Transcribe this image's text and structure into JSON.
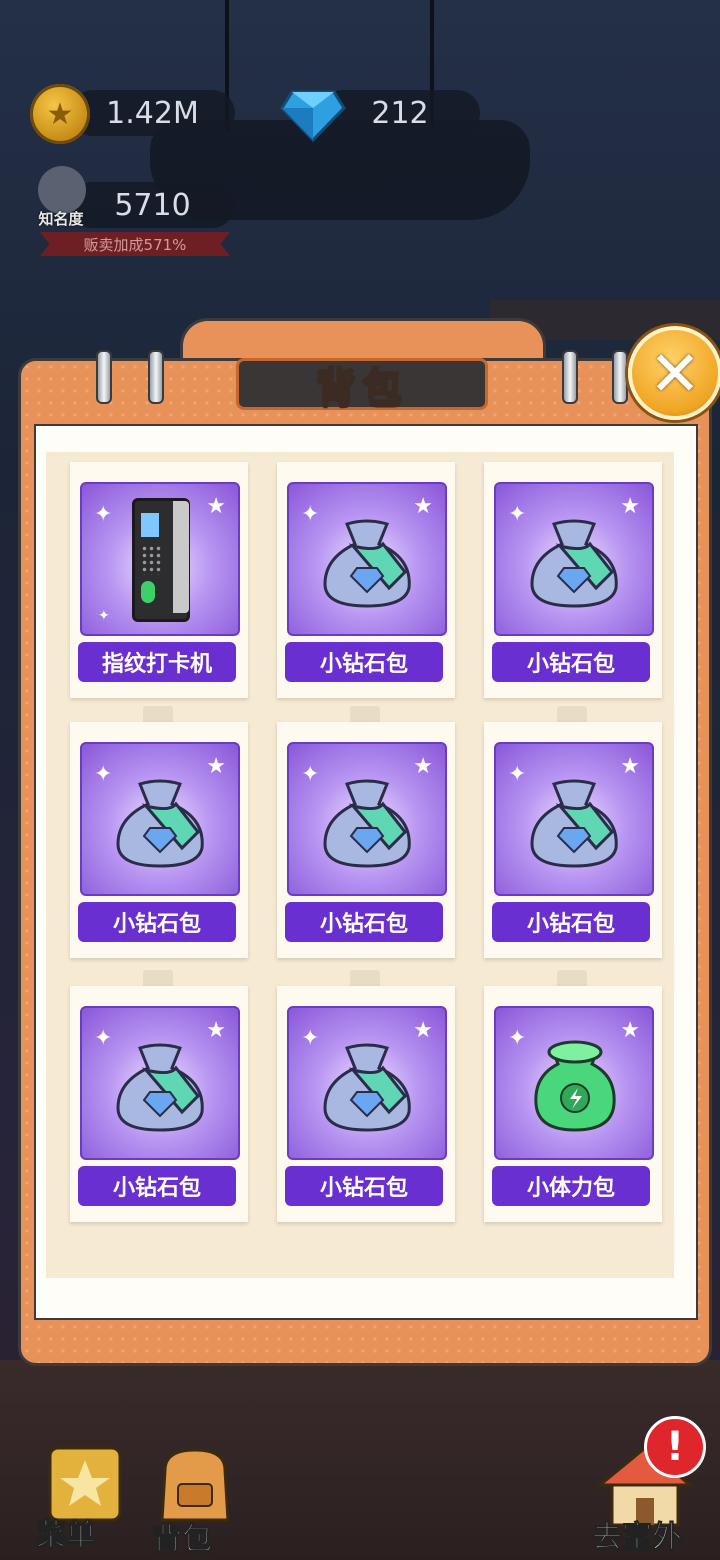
{
  "hud": {
    "coins": "1.42M",
    "diamonds": "212",
    "fame_value": "5710",
    "fame_label": "知名度",
    "sales_bonus": "贩卖加成571%"
  },
  "panel": {
    "title": "背包",
    "close_symbol": "✕"
  },
  "items": [
    {
      "name": "指纹打卡机",
      "icon": "fingerprint-clock-icon"
    },
    {
      "name": "小钻石包",
      "icon": "diamond-bag-icon"
    },
    {
      "name": "小钻石包",
      "icon": "diamond-bag-icon"
    },
    {
      "name": "小钻石包",
      "icon": "diamond-bag-icon"
    },
    {
      "name": "小钻石包",
      "icon": "diamond-bag-icon"
    },
    {
      "name": "小钻石包",
      "icon": "diamond-bag-icon"
    },
    {
      "name": "小钻石包",
      "icon": "diamond-bag-icon"
    },
    {
      "name": "小钻石包",
      "icon": "diamond-bag-icon"
    },
    {
      "name": "小体力包",
      "icon": "stamina-bag-icon"
    }
  ],
  "bottom_nav": {
    "menu": "菜单",
    "bag": "背包",
    "outdoor": "去室外",
    "alert_symbol": "!"
  },
  "colors": {
    "panel_orange": "#e8925a",
    "label_purple": "#6a2fd0",
    "close_gold": "#f0a524"
  }
}
